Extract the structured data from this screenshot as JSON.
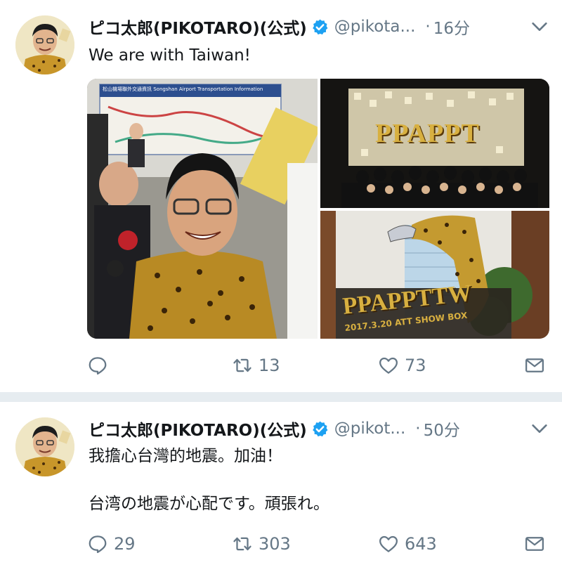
{
  "tweets": [
    {
      "author_name": "ピコ太郎(PIKOTARO)(公式)",
      "handle": "@pikota...",
      "separator": "·",
      "time": "16分",
      "text": "We are with Taiwan!",
      "media": {
        "image1_sign": "松山機場聯外交通資訊 Songshan Airport Transportation Information",
        "image2_text": "PPAPPT",
        "image3_text": "PPAPPTTW",
        "image3_subtext": "2017.3.20 ATT SHOW BOX"
      },
      "reply_count": "",
      "retweet_count": "13",
      "like_count": "73"
    },
    {
      "author_name": "ピコ太郎(PIKOTARO)(公式)",
      "handle": "@pikot...",
      "separator": "·",
      "time": "50分",
      "text": "我擔心台灣的地震。加油！\n\n台湾の地震が心配です。頑張れ。",
      "reply_count": "29",
      "retweet_count": "303",
      "like_count": "643"
    }
  ],
  "colors": {
    "verified": "#1da1f2",
    "muted": "#657786",
    "divider": "#e6ecf0"
  },
  "icons": [
    "verified-badge-icon",
    "chevron-down-icon",
    "reply-icon",
    "retweet-icon",
    "like-icon",
    "share-mail-icon"
  ]
}
